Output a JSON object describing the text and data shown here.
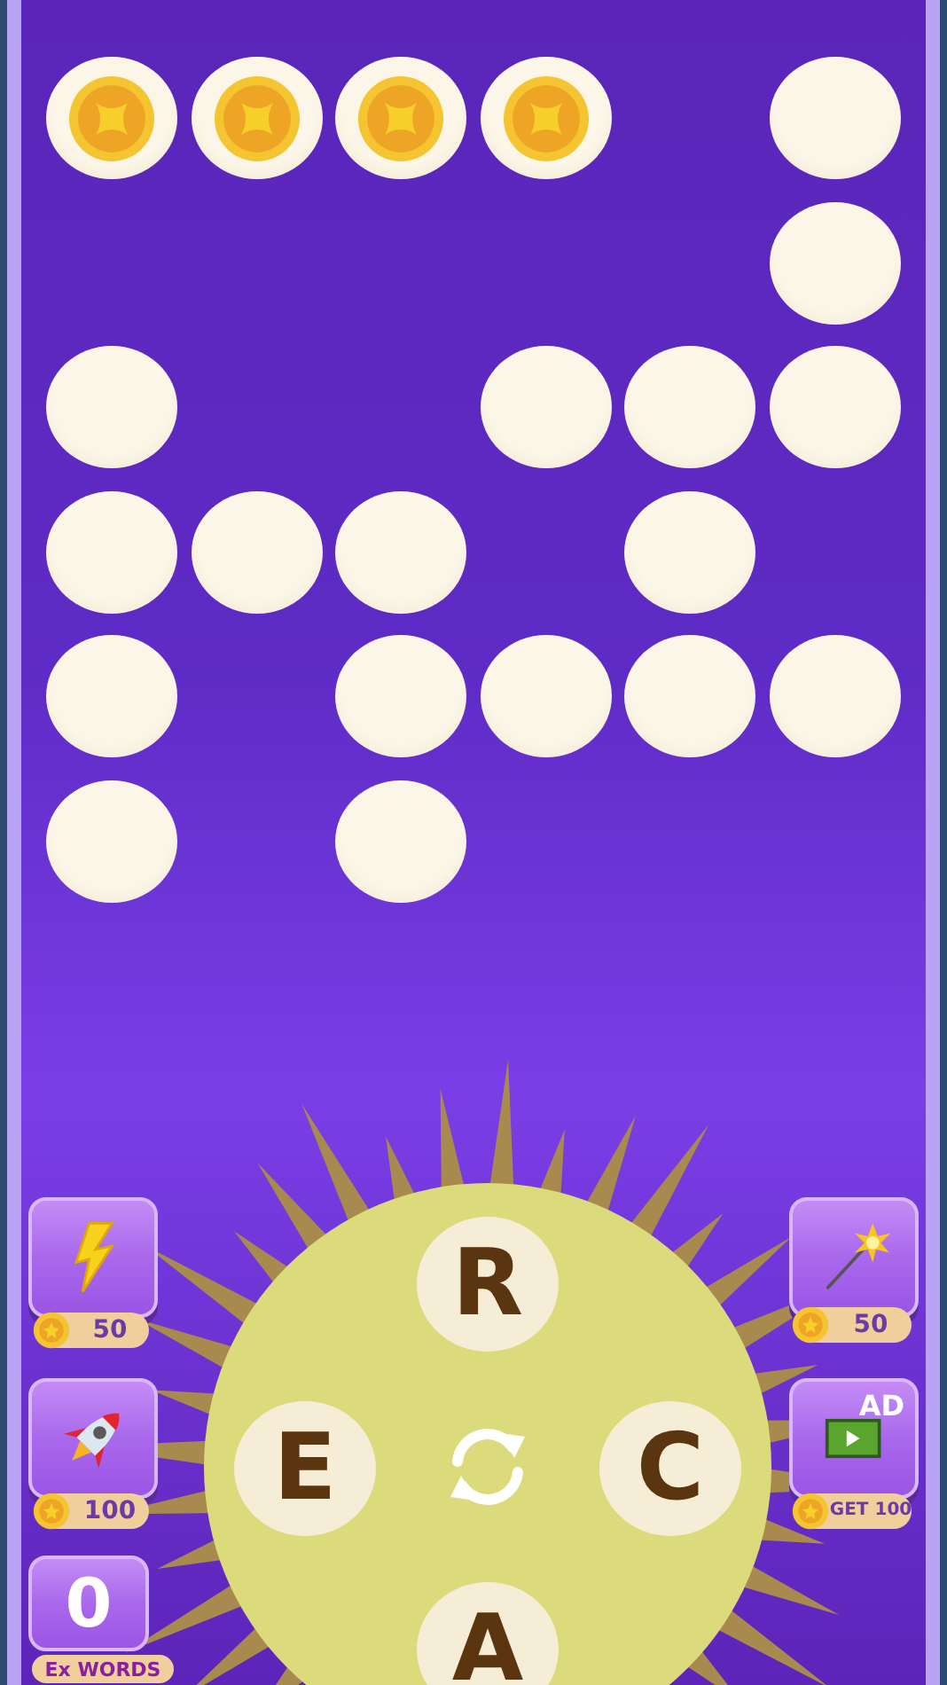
{
  "board": [
    [
      {
        "kind": "coin"
      },
      {
        "kind": "coin"
      },
      {
        "kind": "coin"
      },
      {
        "kind": "coin"
      },
      {
        "kind": "gap"
      },
      {
        "kind": "tile"
      }
    ],
    [
      {
        "kind": "gap"
      },
      {
        "kind": "gap"
      },
      {
        "kind": "gap"
      },
      {
        "kind": "gap"
      },
      {
        "kind": "gap"
      },
      {
        "kind": "tile"
      }
    ],
    [
      {
        "kind": "tile"
      },
      {
        "kind": "gap"
      },
      {
        "kind": "gap"
      },
      {
        "kind": "tile"
      },
      {
        "kind": "tile"
      },
      {
        "kind": "tile"
      }
    ],
    [
      {
        "kind": "tile"
      },
      {
        "kind": "tile"
      },
      {
        "kind": "tile"
      },
      {
        "kind": "gap"
      },
      {
        "kind": "tile"
      },
      {
        "kind": "gap"
      }
    ],
    [
      {
        "kind": "tile"
      },
      {
        "kind": "gap"
      },
      {
        "kind": "tile"
      },
      {
        "kind": "tile"
      },
      {
        "kind": "tile"
      },
      {
        "kind": "tile"
      }
    ],
    [
      {
        "kind": "tile"
      },
      {
        "kind": "gap"
      },
      {
        "kind": "tile"
      },
      {
        "kind": "gap"
      },
      {
        "kind": "gap"
      },
      {
        "kind": "gap"
      }
    ]
  ],
  "left_tools": [
    {
      "kind": "lightning",
      "price": "50"
    },
    {
      "kind": "rocket",
      "price": "100"
    },
    {
      "kind": "counter",
      "value": "0",
      "label": "Ex WORDS"
    }
  ],
  "right_tools": [
    {
      "kind": "wand",
      "price": "50"
    },
    {
      "kind": "ad",
      "badge": "AD",
      "price": "GET 100"
    }
  ],
  "wheel": {
    "letters": [
      "R",
      "E",
      "C",
      "A"
    ]
  }
}
